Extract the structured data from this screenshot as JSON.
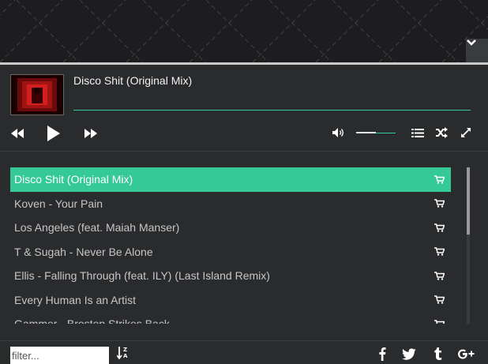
{
  "banner": {
    "collapse_icon": "chevron-down-icon"
  },
  "player": {
    "track_title": "Disco Shit (Original Mix)",
    "progress": 1.0,
    "volume": 0.5,
    "controls": [
      "rewind-icon",
      "play-icon",
      "fast-forward-icon",
      "volume-icon",
      "list-icon",
      "shuffle-icon",
      "expand-icon"
    ],
    "accent": "#34c997"
  },
  "playlist": {
    "items": [
      {
        "label": "Disco Shit (Original Mix)"
      },
      {
        "label": "Koven - Your Pain"
      },
      {
        "label": "Los Angeles (feat. Maiah Manser)"
      },
      {
        "label": "T & Sugah - Never Be Alone"
      },
      {
        "label": "Ellis - Falling Through (feat. ILY) (Last Island Remix)"
      },
      {
        "label": "Every Human Is an Artist"
      },
      {
        "label": "Gammer - Brostep Strikes Back"
      }
    ],
    "active_index": 0,
    "item_icon": "cart-icon"
  },
  "footer": {
    "filter_placeholder": "filter...",
    "sort_icon": "sort-alpha-icon",
    "social": [
      "facebook-icon",
      "twitter-icon",
      "tumblr-icon",
      "google-plus-icon"
    ]
  }
}
